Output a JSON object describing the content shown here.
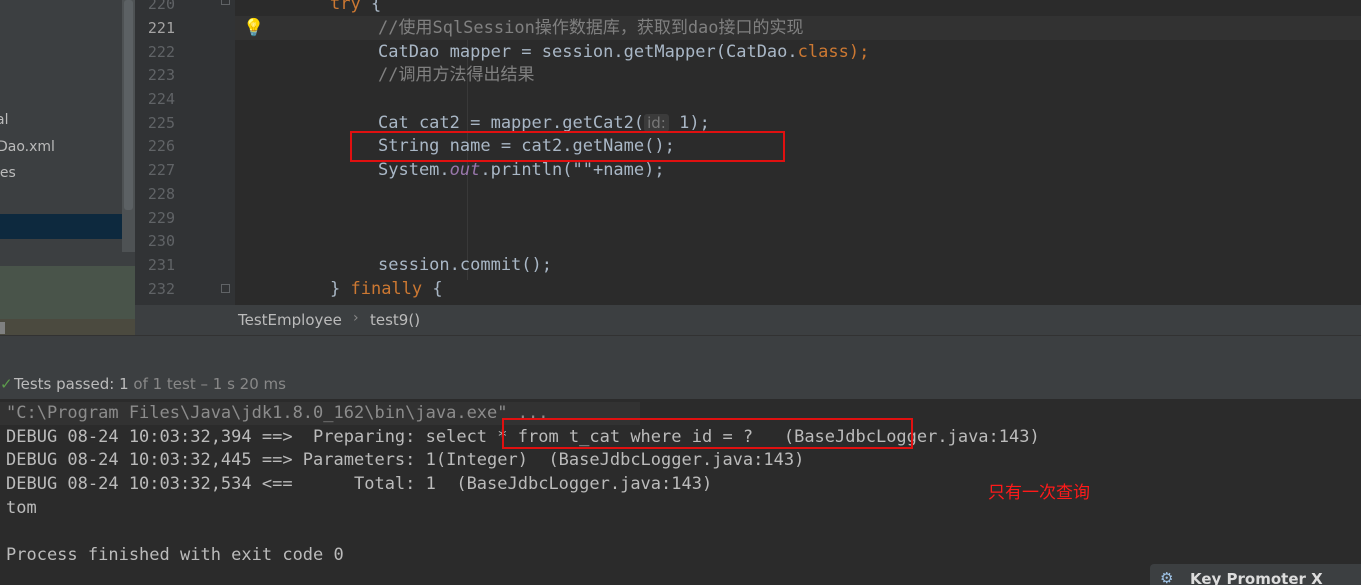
{
  "sidebar": {
    "items": [
      {
        "label": "al"
      },
      {
        "label": "Dao.xml"
      },
      {
        "label": "ies"
      }
    ]
  },
  "editor": {
    "line_numbers": [
      "220",
      "221",
      "222",
      "223",
      "224",
      "225",
      "226",
      "227",
      "228",
      "229",
      "230",
      "231",
      "232"
    ],
    "lines": {
      "l220_kw": "try",
      "l220_rest": " {",
      "l221": "//使用SqlSession操作数据库，获取到dao接口的实现",
      "l222_a": "CatDao mapper = session.getMapper(CatDao.",
      "l222_kw": "class",
      "l222_b": ");",
      "l223": "//调用方法得出结果",
      "l225_a": "Cat cat2 = mapper.getCat2(",
      "l225_hint": "id:",
      "l225_b": " 1);",
      "l226": "String name = cat2.getName();",
      "l227_a": "System.",
      "l227_out": "out",
      "l227_b": ".println(\"\"+name);",
      "l231": "session.commit();",
      "l232_a": "} ",
      "l232_kw": "finally",
      "l232_b": " {"
    }
  },
  "breadcrumb": {
    "class_name": "TestEmployee",
    "method": "test9()",
    "sep": "›"
  },
  "tests": {
    "check": "✓",
    "label": "Tests passed:",
    "count": "1",
    "of": "of 1 test",
    "time": "– 1 s 20 ms"
  },
  "console": {
    "cmd": "\"C:\\Program Files\\Java\\jdk1.8.0_162\\bin\\java.exe\" ...",
    "lines": [
      "DEBUG 08-24 10:03:32,394 ==>  Preparing: select * from t_cat where id = ?   (BaseJdbcLogger.java:143)",
      "DEBUG 08-24 10:03:32,445 ==> Parameters: 1(Integer)  (BaseJdbcLogger.java:143)",
      "DEBUG 08-24 10:03:32,534 <==      Total: 1  (BaseJdbcLogger.java:143)",
      "tom",
      "",
      "Process finished with exit code 0"
    ],
    "note": "只有一次查询"
  },
  "key_promoter": {
    "icon": "key-icon",
    "label": "Key Promoter X"
  },
  "colors": {
    "keyword": "#cc7832",
    "comment": "#808080",
    "annotation_box": "#e01010",
    "note": "#ff1a1a"
  }
}
